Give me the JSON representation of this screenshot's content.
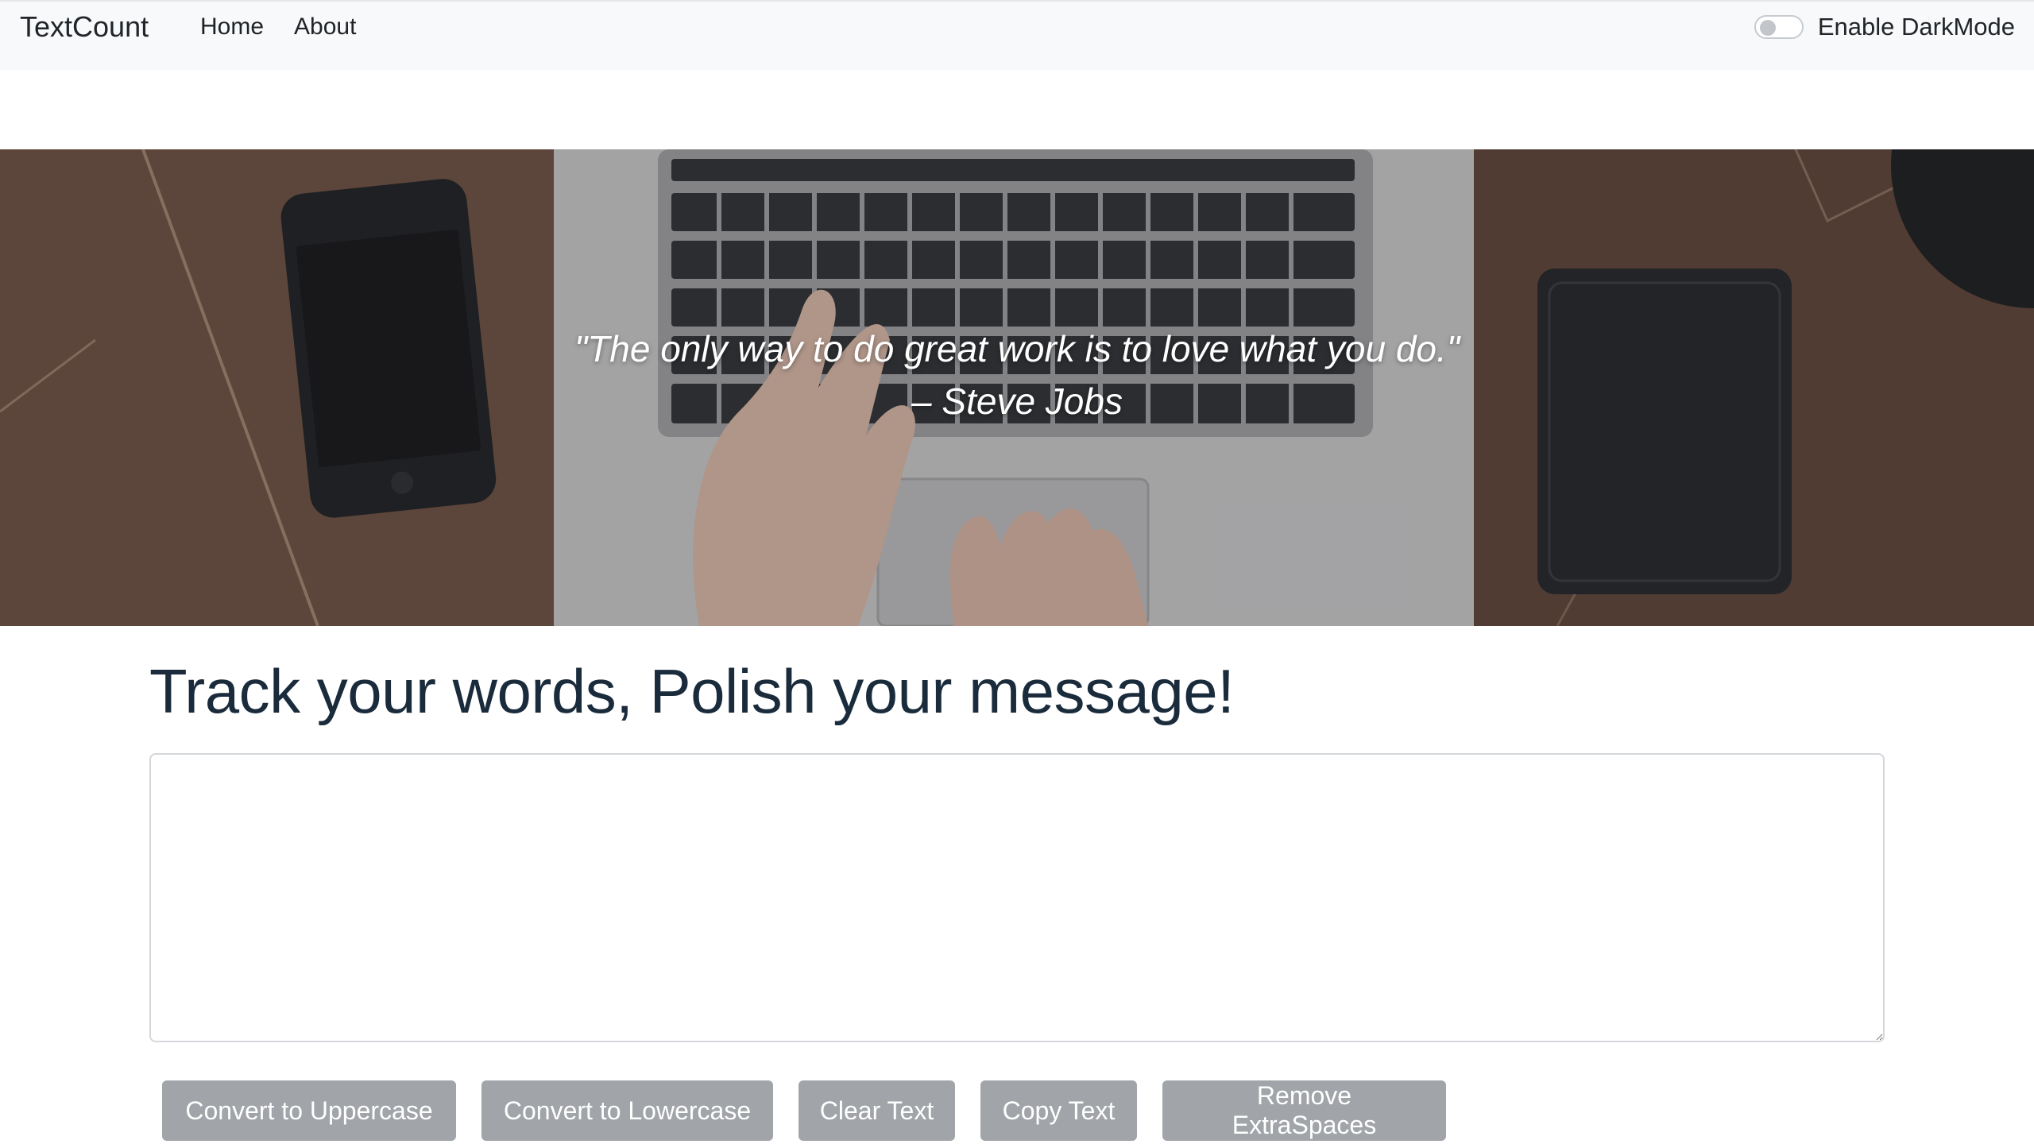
{
  "navbar": {
    "brand": "TextCount",
    "links": [
      {
        "label": "Home"
      },
      {
        "label": "About"
      }
    ],
    "darkmode_toggle": {
      "label": "Enable DarkMode",
      "checked": false
    }
  },
  "hero": {
    "quote": "\"The only way to do great work is to love what you do.\"",
    "author": "– Steve Jobs"
  },
  "main": {
    "heading": "Track your words, Polish your message!",
    "textarea": {
      "value": "",
      "placeholder": ""
    },
    "buttons": [
      {
        "label": "Convert to Uppercase"
      },
      {
        "label": "Convert to Lowercase"
      },
      {
        "label": "Clear Text"
      },
      {
        "label": "Copy Text"
      },
      {
        "label": "Remove ExtraSpaces"
      }
    ]
  },
  "colors": {
    "navbar_bg": "#f8f9fa",
    "heading": "#1a2b3c",
    "button_bg": "#a1a4a8"
  }
}
